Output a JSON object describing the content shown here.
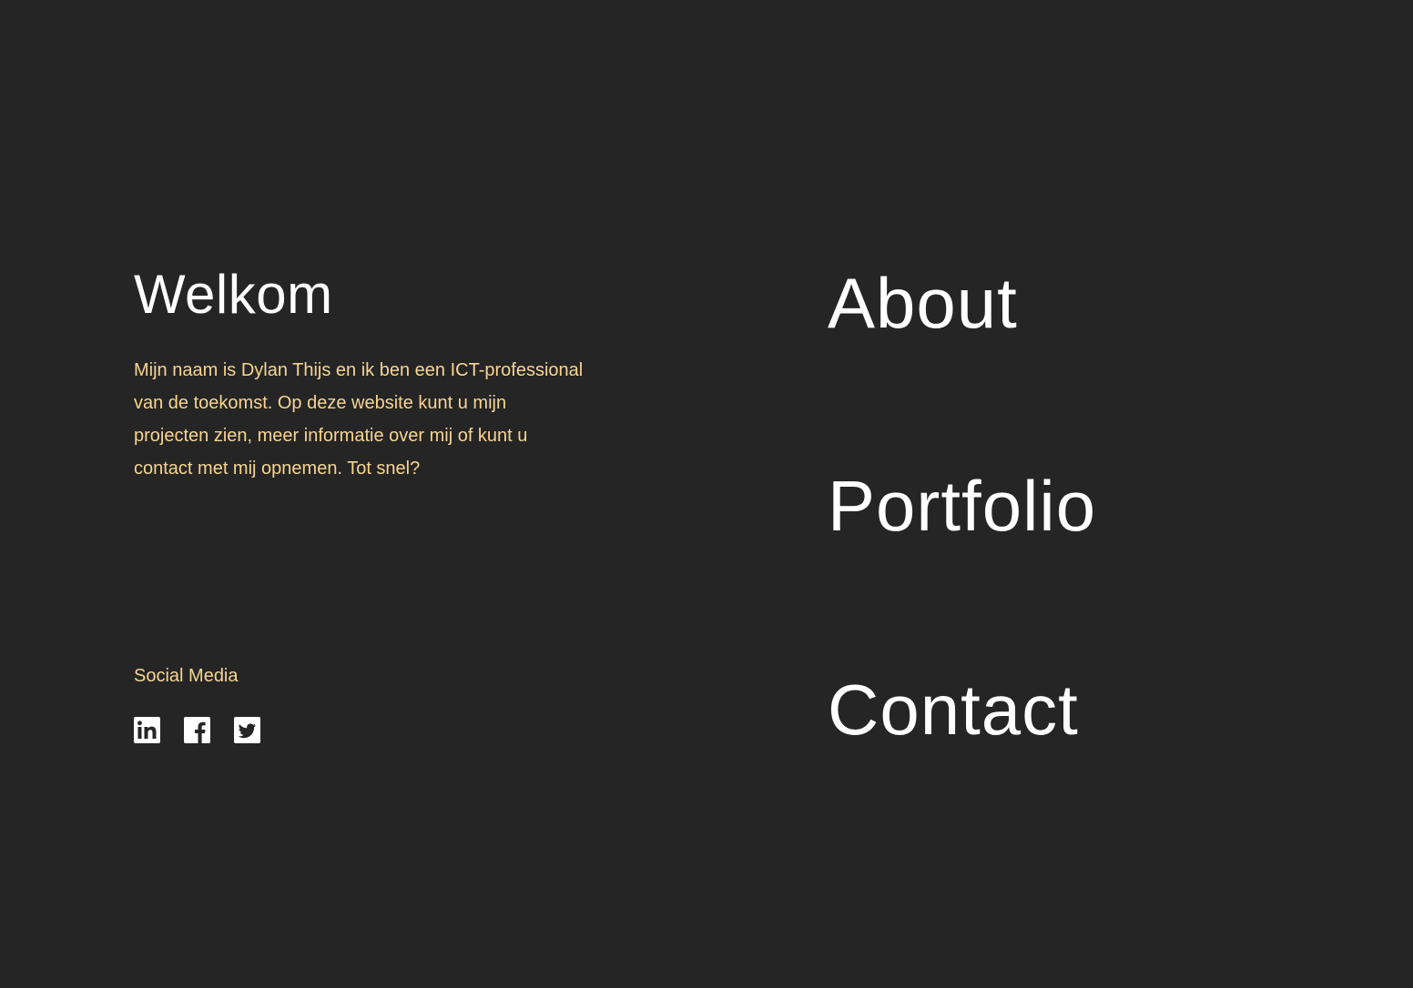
{
  "page": {
    "background": "#252525",
    "accent_color": "#f7d592",
    "text_color": "#ffffff"
  },
  "welcome": {
    "title": "Welkom",
    "text": "Mijn naam is Dylan Thijs en ik ben een ICT-professional van de toekomst. Op deze website kunt u mijn projecten zien, meer informatie over mij of kunt u contact met mij opnemen. Tot snel?"
  },
  "social": {
    "heading": "Social Media",
    "icons": [
      "linkedin-icon",
      "facebook-icon",
      "twitter-icon"
    ]
  },
  "nav": {
    "about": "About",
    "portfolio": "Portfolio",
    "contact": "Contact"
  }
}
